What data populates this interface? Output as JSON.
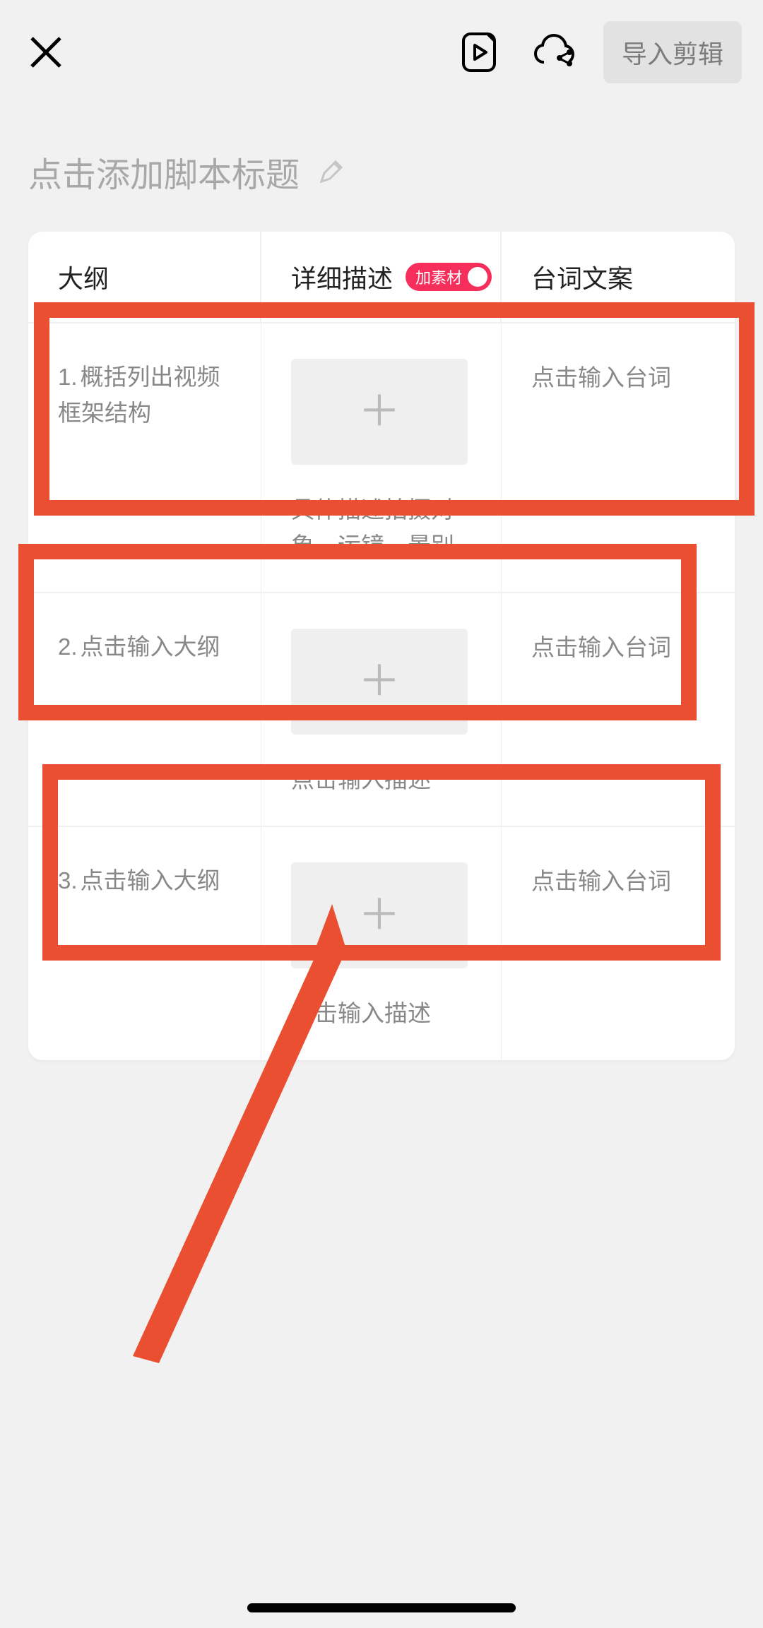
{
  "header": {
    "import_label": "导入剪辑"
  },
  "title": {
    "placeholder": "点击添加脚本标题"
  },
  "columns": {
    "outline": "大纲",
    "detail": "详细描述",
    "toggle_label": "加素材",
    "dialog": "台词文案"
  },
  "rows": [
    {
      "num": "1.",
      "outline": "概括列出视频框架结构",
      "detail_desc": "具体描述拍摄对象、运镜、景别",
      "dialog": "点击输入台词"
    },
    {
      "num": "2.",
      "outline": "点击输入大纲",
      "detail_desc": "点击输入描述",
      "dialog": "点击输入台词"
    },
    {
      "num": "3.",
      "outline": "点击输入大纲",
      "detail_desc": "点击输入描述",
      "dialog": "点击输入台词"
    }
  ]
}
